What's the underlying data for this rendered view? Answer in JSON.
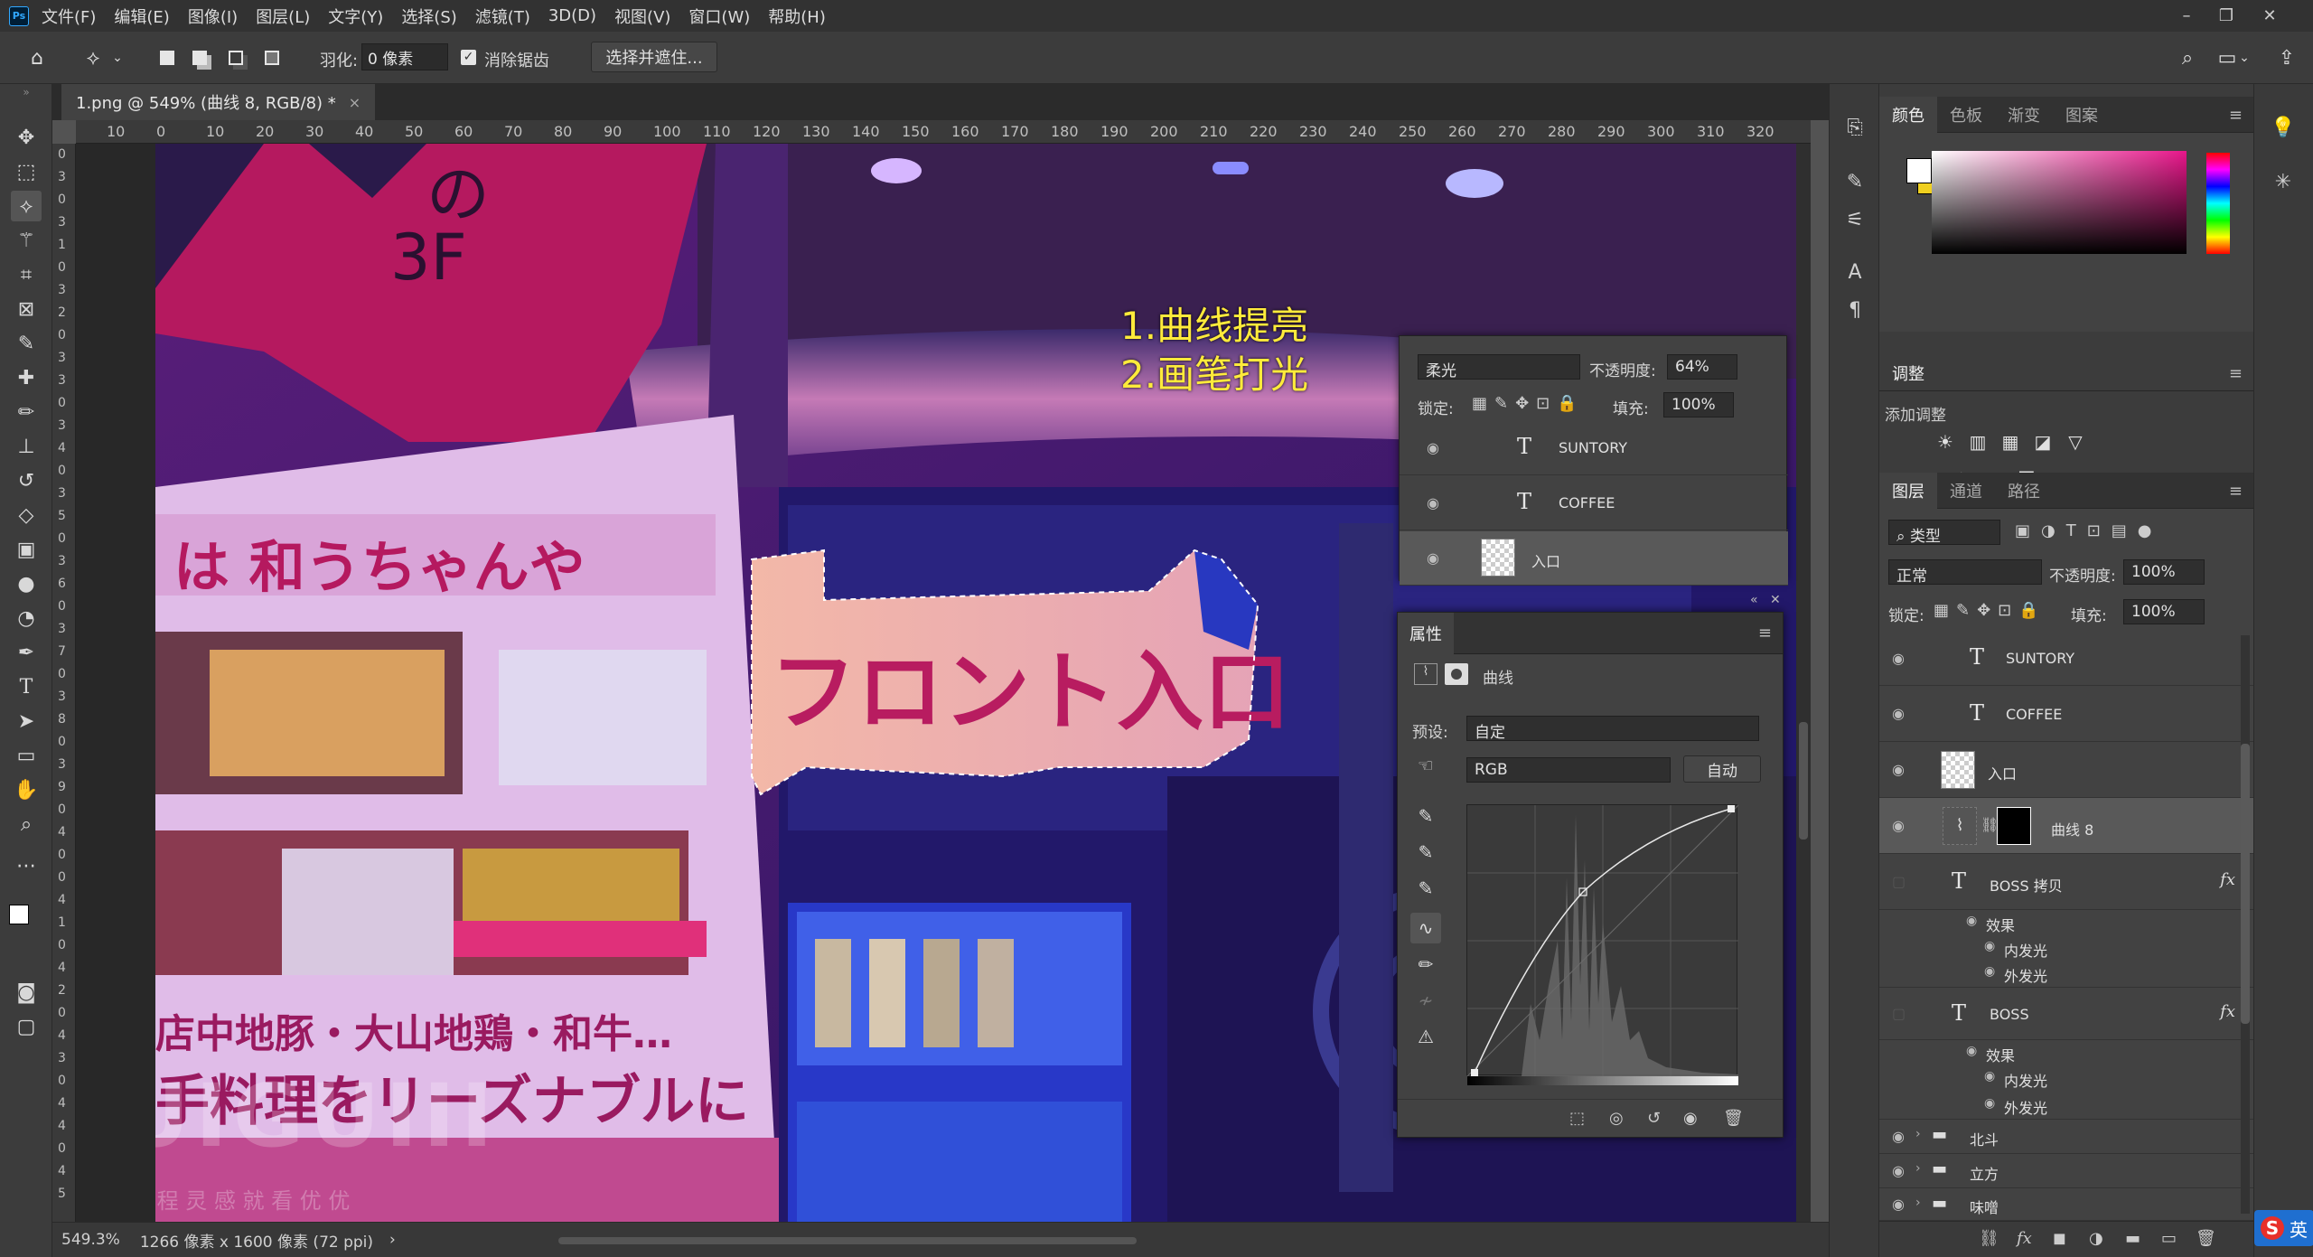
{
  "menubar": {
    "app_logo": "Ps",
    "items": [
      "文件(F)",
      "编辑(E)",
      "图像(I)",
      "图层(L)",
      "文字(Y)",
      "选择(S)",
      "滤镜(T)",
      "3D(D)",
      "视图(V)",
      "窗口(W)",
      "帮助(H)"
    ]
  },
  "window_controls": {
    "minimize": "–",
    "restore": "❐",
    "close": "✕"
  },
  "options_bar": {
    "feather_label": "羽化:",
    "feather_value": "0 像素",
    "antialias_label": "消除锯齿",
    "select_mask_button": "选择并遮住..."
  },
  "document": {
    "tab_title": "1.png @ 549% (曲线 8, RGB/8) *",
    "tab_close": "×"
  },
  "ruler": {
    "h_ticks": [
      "10",
      "0",
      "10",
      "20",
      "30",
      "40",
      "50",
      "60",
      "70",
      "80",
      "90",
      "100",
      "110",
      "120",
      "130",
      "140",
      "150",
      "160",
      "170",
      "180",
      "190",
      "200",
      "210",
      "220",
      "230",
      "240",
      "250",
      "260",
      "270",
      "280",
      "290",
      "300",
      "310",
      "320"
    ],
    "v_ticks": [
      "0",
      "3",
      "0",
      "3",
      "1",
      "0",
      "3",
      "2",
      "0",
      "3",
      "3",
      "0",
      "3",
      "4",
      "0",
      "3",
      "5",
      "0",
      "3",
      "6",
      "0",
      "3",
      "7",
      "0",
      "3",
      "8",
      "0",
      "3",
      "9",
      "0",
      "4",
      "0",
      "0",
      "4",
      "1",
      "0",
      "4",
      "2",
      "0",
      "4",
      "3",
      "0",
      "4",
      "4",
      "0",
      "4",
      "5"
    ]
  },
  "annotations": {
    "line1": "1.曲线提亮",
    "line2": "2.画笔打光"
  },
  "photo_signs": {
    "floor_a": "の",
    "floor_b": "3F",
    "banner": "は 和うちゃんや",
    "sign": "フロント入口",
    "menu_line1": "店中地豚・大山地鶏・和牛…",
    "menu_line2": "手料理をリーズナブルに"
  },
  "watermark": {
    "logo": "UIGUIII",
    "tagline": "教 程 灵 感 就 看 优 优"
  },
  "status": {
    "zoom": "549.3%",
    "doc_info": "1266 像素 x 1600 像素 (72 ppi)",
    "arrow": "›"
  },
  "float_layers": {
    "blend_mode": "柔光",
    "opacity_label": "不透明度:",
    "opacity_value": "64%",
    "lock_label": "锁定:",
    "fill_label": "填充:",
    "fill_value": "100%",
    "rows": [
      {
        "type": "text",
        "name": "SUNTORY"
      },
      {
        "type": "text",
        "name": "COFFEE"
      },
      {
        "type": "pixel",
        "name": "入口"
      }
    ]
  },
  "properties": {
    "title": "属性",
    "adjustment_name": "曲线",
    "preset_label": "预设:",
    "preset_value": "自定",
    "channel_value": "RGB",
    "auto_button": "自动"
  },
  "color_panel": {
    "tabs": [
      "颜色",
      "色板",
      "渐变",
      "图案"
    ],
    "foreground": "#ffffff",
    "background": "#f0d020",
    "hue_marker": "#e8168a"
  },
  "adjust_panel": {
    "title": "调整",
    "add_label": "添加调整",
    "row1": [
      "☀",
      "▥",
      "▦",
      "◪",
      "▽"
    ],
    "row2": [
      "▤",
      "⚖",
      "◧",
      "◙",
      "◍",
      "▦"
    ],
    "row3": [
      "◩",
      "◪",
      "◈",
      "◫",
      "◨"
    ]
  },
  "layers_panel": {
    "tabs": [
      "图层",
      "通道",
      "路径"
    ],
    "filter_label": "类型",
    "blend_mode": "正常",
    "opacity_label": "不透明度:",
    "opacity_value": "100%",
    "lock_label": "锁定:",
    "fill_label": "填充:",
    "fill_value": "100%",
    "layers": [
      {
        "name": "SUNTORY",
        "type": "text"
      },
      {
        "name": "COFFEE",
        "type": "text"
      },
      {
        "name": "入口",
        "type": "pixel"
      },
      {
        "name": "曲线 8",
        "type": "adjustment",
        "selected": true
      },
      {
        "name": "BOSS 拷贝",
        "type": "text",
        "fx": "fx"
      },
      {
        "name": "效果",
        "type": "effect-group"
      },
      {
        "name": "内发光",
        "type": "effect"
      },
      {
        "name": "外发光",
        "type": "effect"
      },
      {
        "name": "BOSS",
        "type": "text",
        "fx": "fx"
      },
      {
        "name": "效果",
        "type": "effect-group"
      },
      {
        "name": "内发光",
        "type": "effect"
      },
      {
        "name": "外发光",
        "type": "effect"
      },
      {
        "name": "北斗",
        "type": "group"
      },
      {
        "name": "立方",
        "type": "group"
      },
      {
        "name": "味噌",
        "type": "group"
      }
    ],
    "bottom_icons": [
      "⛓",
      "fx",
      "◼",
      "◑",
      "▬",
      "▭",
      "🗑"
    ]
  },
  "ime": {
    "logo": "S",
    "label": "英"
  }
}
